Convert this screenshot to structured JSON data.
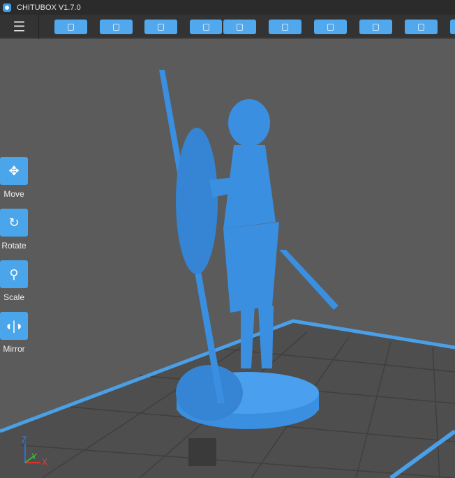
{
  "window": {
    "title": "CHITUBOX V1.7.0"
  },
  "toolbar": {
    "buttons": [
      "open-file",
      "save",
      "auto-layout",
      "import",
      "export",
      "slice-settings",
      "supports",
      "hollow",
      "settings",
      "more"
    ]
  },
  "tools": [
    {
      "label": "Move"
    },
    {
      "label": "Rotate"
    },
    {
      "label": "Scale"
    },
    {
      "label": "Mirror"
    }
  ],
  "axes": {
    "z": "Z",
    "y": "Y",
    "x": "X"
  },
  "colors": {
    "accent": "#4aa5ea",
    "model": "#3a8fe0",
    "background": "#5b5b5b"
  }
}
